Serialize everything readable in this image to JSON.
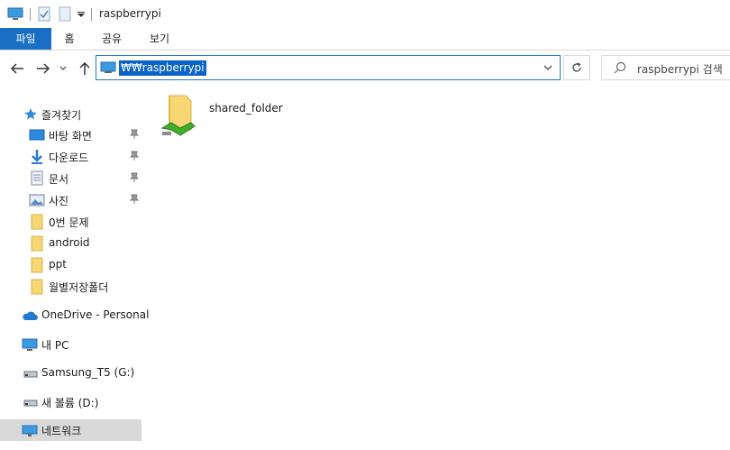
{
  "window": {
    "title": "raspberrypi"
  },
  "ribbon": {
    "tabs": [
      {
        "label": "파일",
        "active": true
      },
      {
        "label": "홈"
      },
      {
        "label": "공유"
      },
      {
        "label": "보기"
      }
    ]
  },
  "address": {
    "path": "₩₩raspberrypi",
    "search_placeholder": "raspberrypi 검색"
  },
  "sidebar": {
    "quick_access": "즐겨찾기",
    "items": [
      {
        "label": "바탕 화면",
        "icon": "desktop-icon",
        "pinned": true
      },
      {
        "label": "다운로드",
        "icon": "download-icon",
        "pinned": true
      },
      {
        "label": "문서",
        "icon": "documents-icon",
        "pinned": true
      },
      {
        "label": "사진",
        "icon": "pictures-icon",
        "pinned": true
      },
      {
        "label": "0번 문제",
        "icon": "folder-icon"
      },
      {
        "label": "android",
        "icon": "folder-icon"
      },
      {
        "label": "ppt",
        "icon": "folder-icon"
      },
      {
        "label": "월별저장폴더",
        "icon": "folder-icon"
      }
    ],
    "onedrive": "OneDrive - Personal",
    "this_pc": "내 PC",
    "drive1": "Samsung_T5 (G:)",
    "drive2": "새 볼륨 (D:)",
    "network": "네트워크"
  },
  "content": {
    "items": [
      {
        "label": "shared_folder",
        "icon": "shared-folder-icon"
      }
    ]
  },
  "colors": {
    "accent": "#1a6fc5",
    "selection": "#0a63c9",
    "nav_selected": "#d9d9d9"
  }
}
